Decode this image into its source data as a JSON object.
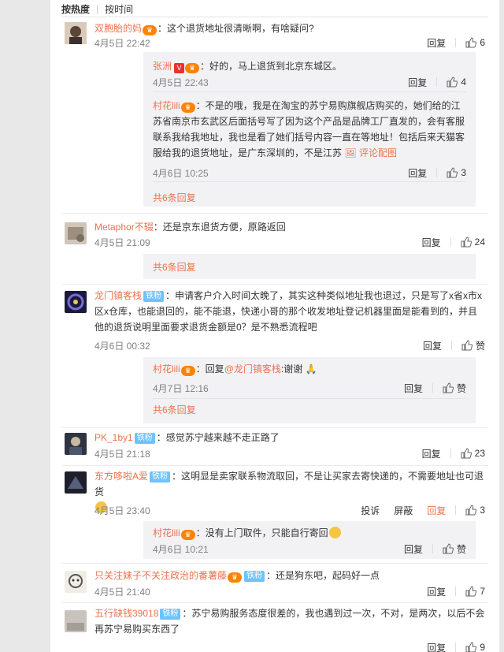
{
  "sort": {
    "active": "按热度",
    "other": "按时间"
  },
  "comments": [
    {
      "user": "双胞胎的妈",
      "text": "：这个退货地址很清晰啊，有啥疑问?",
      "time": "4月5日 22:42",
      "reply": "回复",
      "likes": "6"
    },
    {
      "user": "Metaphor不辍",
      "text": "：还是京东退货方便，原路返回",
      "time": "4月5日 21:09",
      "reply": "回复",
      "likes": "24"
    },
    {
      "user": "龙门镇客栈",
      "badge": "铁粉",
      "text": "：申请客户介入时间太晚了，其实这种类似地址我也退过，只是写了x省x市x区x仓库，也能退回的，能不能退，快递小哥的那个收发地址登记机器里面是能看到的，并且他的退货说明里面要求退货金额是0？是不熟悉流程吧",
      "time": "4月6日 00:32",
      "reply": "回复",
      "likes": "赞"
    },
    {
      "user": "PK_1by1",
      "badge": "铁粉",
      "text": "：感觉苏宁越来越不走正路了",
      "time": "4月5日 21:18",
      "reply": "回复",
      "likes": "23"
    },
    {
      "user": "东方哆啦A爱",
      "badge": "铁粉",
      "text": "：这明显是卖家联系物流取回，不是让买家去寄快递的，不需要地址也可退货",
      "time": "4月5日 23:40",
      "report": "投诉",
      "block": "屏蔽",
      "reply": "回复",
      "likes": "3"
    },
    {
      "user": "只关注妹子不关注政治的番薯藤",
      "badge": "铁粉",
      "text": "：还是狗东吧，起码好一点",
      "time": "4月5日 21:40",
      "reply": "回复",
      "likes": "7"
    },
    {
      "user": "五行缺钱39018",
      "badge": "铁粉",
      "text": "：苏宁易购服务态度很差的，我也遇到过一次，不对，是两次，以后不会再苏宁易购买东西了",
      "time": "",
      "reply": "回复",
      "likes": "9"
    }
  ],
  "subs": [
    {
      "user": "张洲",
      "text": "：好的，马上退货到北京东城区。",
      "time": "4月5日 22:43",
      "reply": "回复",
      "likes": "4"
    },
    {
      "user": "村花lili",
      "text": "：不是的哦，我是在淘宝的苏宁易购旗舰店购买的，她们给的江苏省南京市玄武区后面括号写了因为这个产品是品牌工厂直发的，会有客服联系我给我地址，我也是看了她们括号内容一直在等地址！包括后来天猫客服给我的退货地址，是广东深圳的，不是江苏",
      "link": "评论配图",
      "time": "4月6日 10:25",
      "reply": "回复",
      "likes": "3"
    },
    {
      "user": "村花lili",
      "prefix": "：回复",
      "mention": "@龙门镇客栈",
      "text": ":谢谢",
      "time": "4月7日 12:16",
      "reply": "回复",
      "likes": "赞"
    },
    {
      "user": "村花lili",
      "text": "：没有上门取件，只能自行寄回",
      "time": "4月6日 10:21",
      "reply": "回复",
      "likes": "赞"
    }
  ],
  "more": {
    "first": "共6条回复",
    "second": "共6条回复",
    "third": "共6条回复"
  },
  "colors": {
    "accent": "#eb7350",
    "badge": "#6ec3ff",
    "subbg": "#f2f2f5"
  }
}
